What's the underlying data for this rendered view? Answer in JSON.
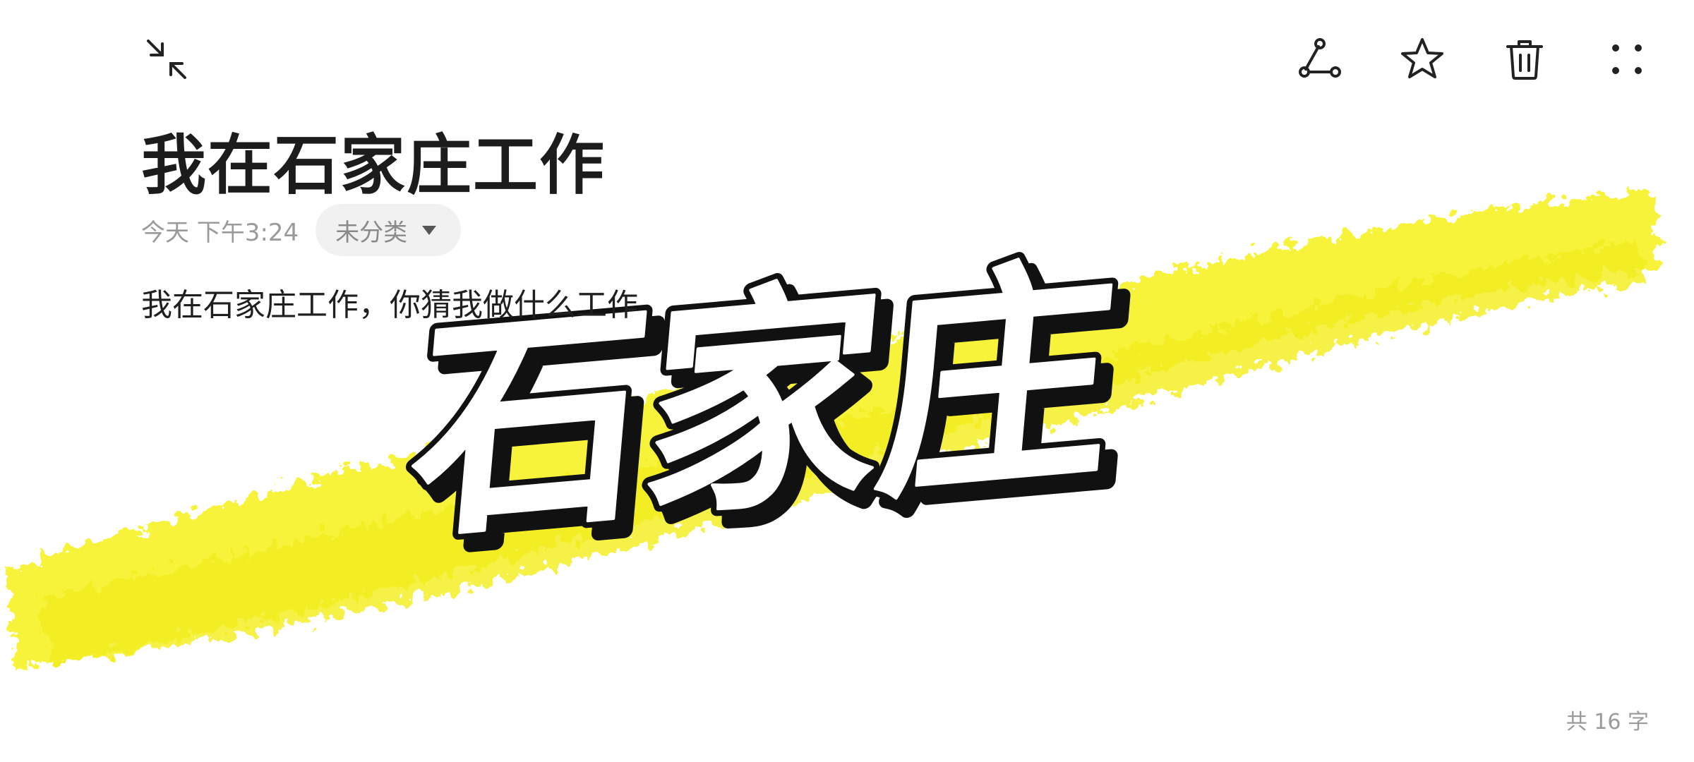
{
  "toolbar": {
    "collapse_icon": "collapse-arrows-icon",
    "share_icon": "share-nodes-icon",
    "favorite_icon": "star-icon",
    "delete_icon": "trash-icon",
    "more_icon": "four-dots-menu-icon"
  },
  "note": {
    "title": "我在石家庄工作",
    "timestamp": "今天 下午3:24",
    "category": "未分类",
    "body": "我在石家庄工作，你猜我做什么工作",
    "image_text": "石家庄",
    "word_count": "共 16 字"
  },
  "colors": {
    "highlight_yellow": "#f7f22f",
    "text_primary": "#1c1c1c",
    "text_secondary": "#9a9a9a",
    "chip_bg": "#f1f1f1"
  }
}
